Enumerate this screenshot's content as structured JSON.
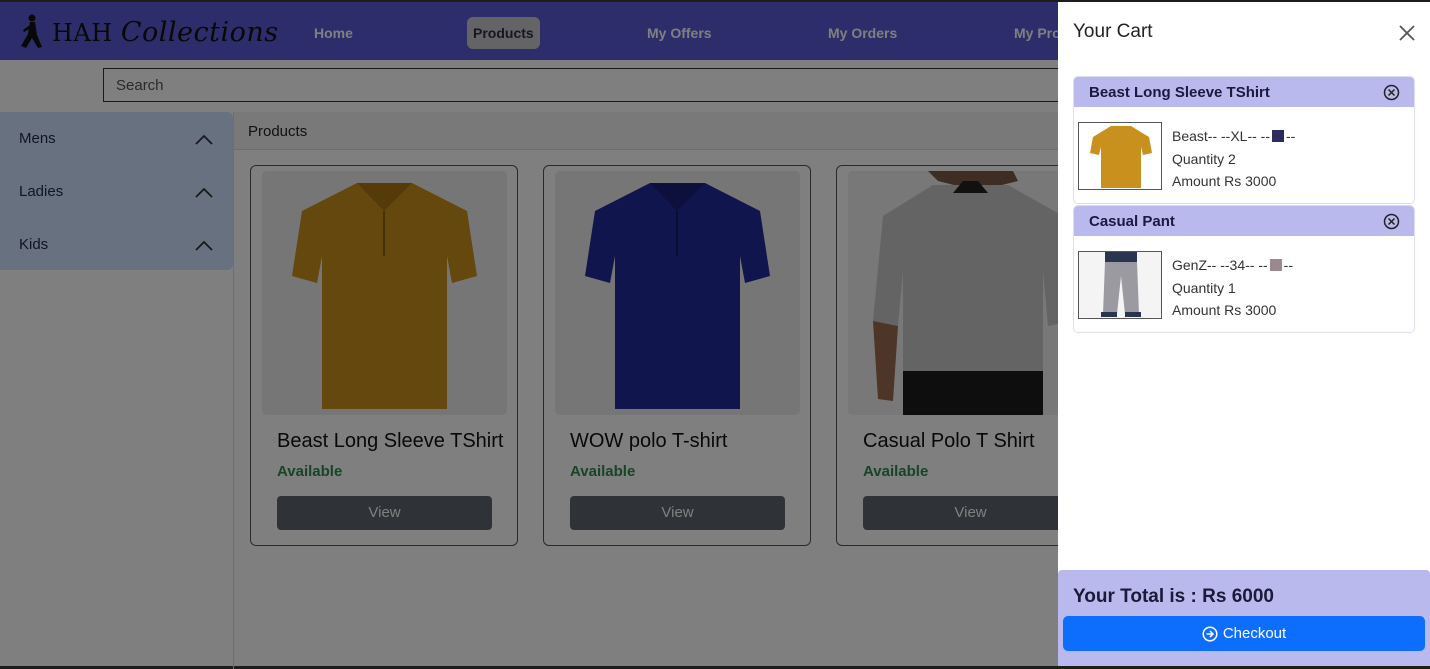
{
  "brand": {
    "name_prefix": "HAH",
    "name_script": "Collections"
  },
  "nav": {
    "home": "Home",
    "products": "Products",
    "offers": "My Offers",
    "orders": "My Orders",
    "profile_partial": "My Pro"
  },
  "search": {
    "placeholder": "Search"
  },
  "sidebar": {
    "items": [
      {
        "label": "Mens",
        "icon": "chevron-up-icon"
      },
      {
        "label": "Ladies",
        "icon": "chevron-up-icon"
      },
      {
        "label": "Kids",
        "icon": "chevron-up-icon"
      }
    ]
  },
  "content": {
    "title": "Products"
  },
  "products": [
    {
      "name": "Beast Long Sleeve TShirt",
      "status": "Available",
      "action": "View",
      "color": "#c8901c"
    },
    {
      "name": "WOW polo T-shirt",
      "status": "Available",
      "action": "View",
      "color": "#232a9a"
    },
    {
      "name": "Casual Polo T Shirt",
      "status": "Available",
      "action": "View",
      "color": "#c9c9c9"
    }
  ],
  "cart": {
    "title": "Your Cart",
    "items": [
      {
        "name": "Beast Long Sleeve TShirt",
        "variant_prefix": "Beast-- --XL-- --",
        "variant_suffix": "--",
        "swatch": "#2b2b5e",
        "quantity": "Quantity 2",
        "amount": "Amount Rs 3000"
      },
      {
        "name": "Casual Pant",
        "variant_prefix": "GenZ-- --34-- --",
        "variant_suffix": "--",
        "swatch": "#9a8a90",
        "quantity": "Quantity 1",
        "amount": "Amount Rs 3000"
      }
    ],
    "total": "Your Total is : Rs 6000",
    "checkout": "Checkout"
  },
  "colors": {
    "navbar": "#5b5bd6",
    "accent": "#0d6efd",
    "cart_header": "#b9b9ee",
    "available": "#2e8b4a"
  }
}
